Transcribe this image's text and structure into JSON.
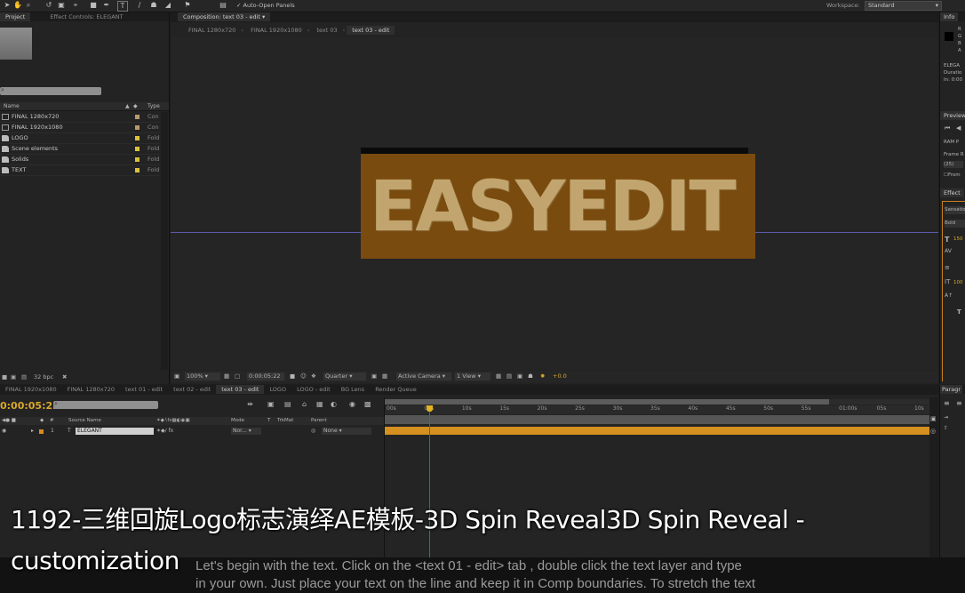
{
  "toolbar": {
    "auto_open_panels": "Auto-Open Panels",
    "workspace_label": "Workspace:",
    "workspace_value": "Standard"
  },
  "project_panel": {
    "tab_project": "Project",
    "tab_effect_controls": "Effect Controls: ELEGANT",
    "search_placeholder": "",
    "col_name": "Name",
    "col_type": "Type",
    "items": [
      {
        "name": "FINAL 1280x720",
        "type": "Con",
        "icon": "composition-icon",
        "label_color": "#b89a6a"
      },
      {
        "name": "FINAL 1920x1080",
        "type": "Con",
        "icon": "composition-icon",
        "label_color": "#b89a6a"
      },
      {
        "name": "LOGO",
        "type": "Fold",
        "icon": "folder-icon",
        "label_color": "#d8c33a"
      },
      {
        "name": "Scene elements",
        "type": "Fold",
        "icon": "folder-icon",
        "label_color": "#d8c33a"
      },
      {
        "name": "Solids",
        "type": "Fold",
        "icon": "folder-icon",
        "label_color": "#d8c33a"
      },
      {
        "name": "TEXT",
        "type": "Fold",
        "icon": "folder-icon",
        "label_color": "#d8c33a"
      }
    ],
    "bpc": "32 bpc"
  },
  "composition": {
    "tab_title": "Composition: text 03 - edit",
    "breadcrumbs": [
      "FINAL 1280x720",
      "FINAL 1920x1080",
      "text 03",
      "text 03 - edit"
    ],
    "canvas_text": "EASYEDIT",
    "zoom": "100%",
    "timecode": "0:00:05:22",
    "resolution": "Quarter",
    "camera": "Active Camera",
    "view": "1 View",
    "exposure": "+0.0",
    "accent_color": "#c8801e"
  },
  "right_panels": {
    "info_tab": "Info",
    "info_letters": [
      "R",
      "G",
      "B",
      "A"
    ],
    "info_text": [
      "ELEGA",
      "Duratio",
      "In: 0:00"
    ],
    "preview_tab": "Preview",
    "ram_label": "RAM P",
    "frame_label": "Frame R",
    "frame_value": "(25)",
    "from_label": "From",
    "effects_tab": "Effect",
    "font_value": "Sansatio",
    "style_value": "Bold",
    "size_value": "150",
    "tracking_value": "100",
    "paragraph_tab": "Paragr"
  },
  "timeline": {
    "tabs": [
      "FINAL 1920x1080",
      "FINAL 1280x720",
      "text 01 - edit",
      "text 02 - edit",
      "text 03 - edit",
      "LOGO",
      "LOGO - edit",
      "BG Lens",
      "Render Queue"
    ],
    "active_tab_index": 4,
    "timecode": "0:00:05:22",
    "col_source_name": "Source Name",
    "col_mode": "Mode",
    "col_t": "T",
    "col_trkmat": "TrkMat",
    "col_parent": "Parent",
    "layer_number": "1",
    "layer_name": "ELEGANT",
    "layer_mode": "Nor...",
    "layer_parent": "None",
    "ruler_ticks": [
      "00s",
      "05s",
      "10s",
      "15s",
      "20s",
      "25s",
      "30s",
      "35s",
      "40s",
      "45s",
      "50s",
      "55s",
      "01:00s",
      "05s",
      "10s"
    ],
    "playhead_fraction": 0.082
  },
  "caption": "1192-三维回旋Logo标志演绎AE模板-3D Spin Reveal3D Spin Reveal - customization",
  "tutorial_lines": [
    "Let's begin with the text. Click on the <text 01 - edit> tab , double click the text layer and type",
    "in your own. Just place your text on the line and keep it in Comp boundaries. To stretch the text"
  ]
}
